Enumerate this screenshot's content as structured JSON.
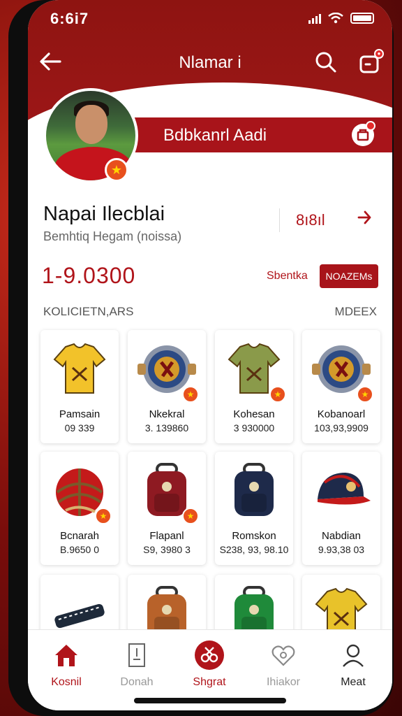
{
  "status_bar": {
    "time": "6:6i7"
  },
  "topbar": {
    "back_icon": "arrow-left-icon",
    "title": "Nlamar i",
    "search_icon": "search-icon",
    "bag_icon": "shopping-bag-icon"
  },
  "banner": {
    "label": "Bdbkanrl Aadi"
  },
  "profile": {
    "name": "Napai Ilecblai",
    "subtitle": "Bemhtiq Hegam (noissa)",
    "follow_count": "8ı8ıl",
    "amount": "1-9.0300",
    "secondary_link": "Sbentka",
    "primary_button": "NOAZEMs"
  },
  "section": {
    "title": "KOLICIETN,ARS",
    "link": "MDEEX"
  },
  "products": [
    {
      "name": "Pamsain",
      "price": "09 339",
      "icon": "jersey-icon",
      "color": "#f2c22a",
      "starred": false
    },
    {
      "name": "Nkekral",
      "price": "3. 139860",
      "icon": "badge-icon",
      "color": "#2c4a84",
      "starred": true
    },
    {
      "name": "Kohesan",
      "price": "3 930000",
      "icon": "jersey-icon",
      "color": "#8a9a4a",
      "starred": true
    },
    {
      "name": "Kobanoarl",
      "price": "103,93,9909",
      "icon": "badge-icon",
      "color": "#2c4a84",
      "starred": true
    },
    {
      "name": "Bcnarah",
      "price": "B.9650 0",
      "icon": "ball-icon",
      "color": "#c41a1a",
      "starred": true
    },
    {
      "name": "Flapanl",
      "price": "S9, 3980 3",
      "icon": "backpack-icon",
      "color": "#8e1a22",
      "starred": true
    },
    {
      "name": "Romskon",
      "price": "S238, 93, 98.10",
      "icon": "backpack-icon",
      "color": "#1e2a4a",
      "starred": false
    },
    {
      "name": "Nabdian",
      "price": "9.93,38 03",
      "icon": "cap-icon",
      "color": "#1e2a4a",
      "starred": false
    },
    {
      "name": "",
      "price": "",
      "icon": "scarf-icon",
      "color": "#1e2a3a",
      "starred": false
    },
    {
      "name": "",
      "price": "",
      "icon": "backpack-icon",
      "color": "#b8622a",
      "starred": false
    },
    {
      "name": "",
      "price": "",
      "icon": "backpack-icon",
      "color": "#1f8a3a",
      "starred": false
    },
    {
      "name": "",
      "price": "",
      "icon": "jersey-icon",
      "color": "#e8c22a",
      "starred": false
    }
  ],
  "bottom_nav": [
    {
      "label": "Kosnil",
      "icon": "home-icon",
      "active": true
    },
    {
      "label": "Donah",
      "icon": "document-icon",
      "active": false
    },
    {
      "label": "Shgrat",
      "icon": "scissors-icon",
      "active": true
    },
    {
      "label": "Ihiakor",
      "icon": "heart-icon",
      "active": false
    },
    {
      "label": "Meat",
      "icon": "user-icon",
      "active": false
    }
  ],
  "colors": {
    "brand": "#a8141a",
    "accent_star": "#e8501d"
  }
}
